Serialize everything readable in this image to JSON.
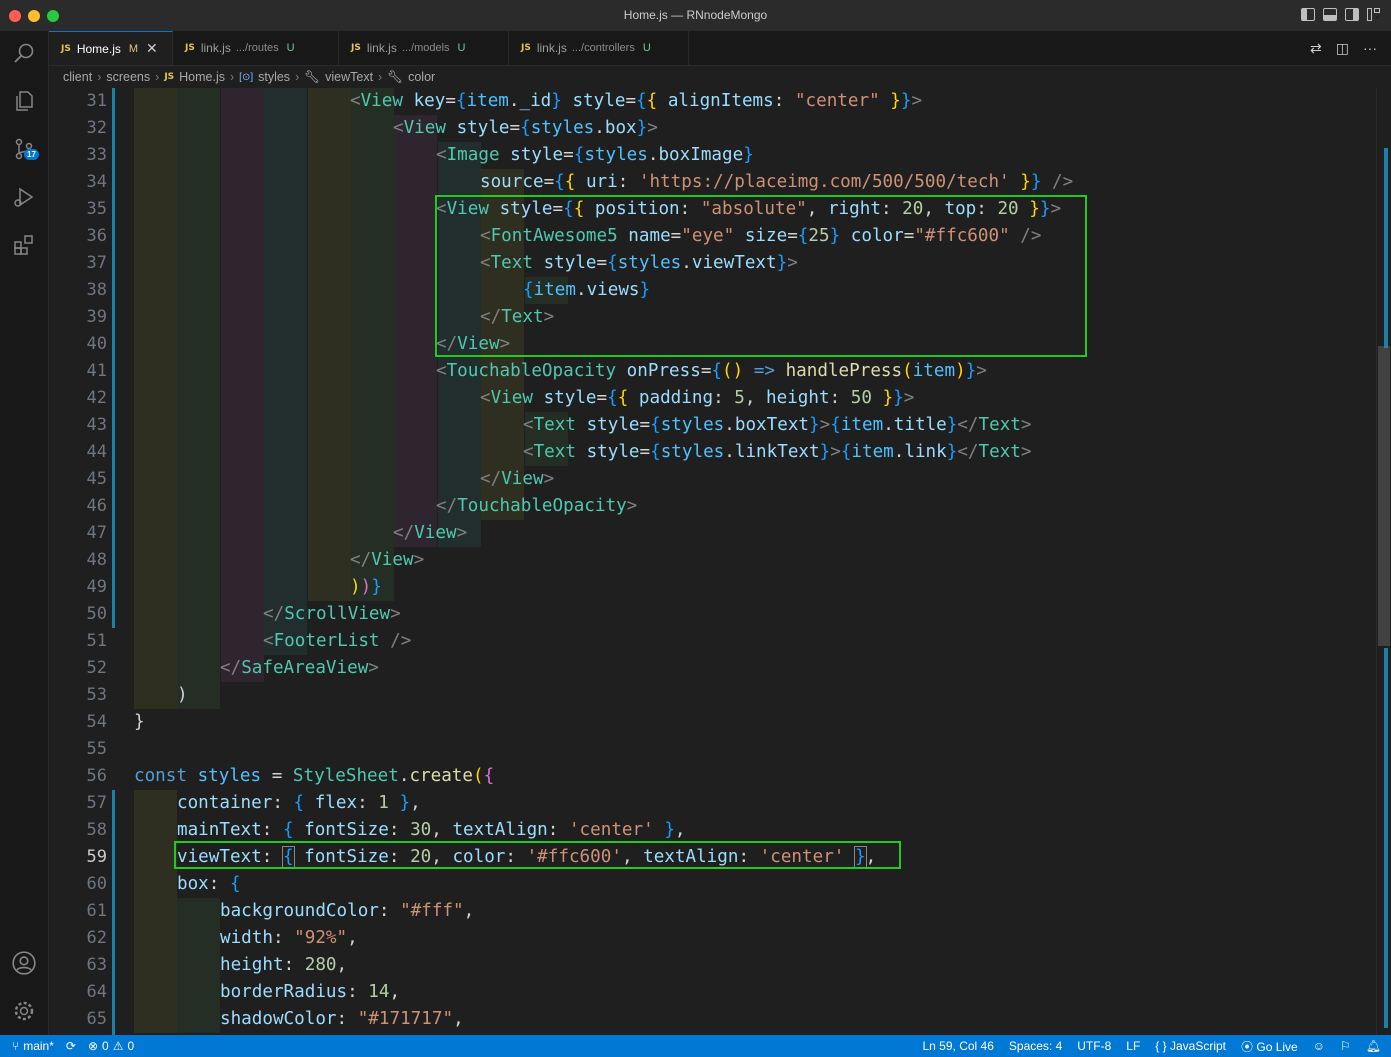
{
  "window": {
    "title": "Home.js — RNnodeMongo"
  },
  "tabs": [
    {
      "label": "Home.js",
      "path": "",
      "status": "M",
      "active": true
    },
    {
      "label": "link.js",
      "path": ".../routes",
      "status": "U",
      "active": false
    },
    {
      "label": "link.js",
      "path": ".../models",
      "status": "U",
      "active": false
    },
    {
      "label": "link.js",
      "path": ".../controllers",
      "status": "U",
      "active": false
    }
  ],
  "breadcrumb": [
    "client",
    "screens",
    "Home.js",
    "styles",
    "viewText",
    "color"
  ],
  "activity": {
    "badge": "17"
  },
  "editor": {
    "current_line": "59",
    "line_numbers": [
      "31",
      "32",
      "33",
      "34",
      "35",
      "36",
      "37",
      "38",
      "39",
      "40",
      "41",
      "42",
      "43",
      "44",
      "45",
      "46",
      "47",
      "48",
      "49",
      "50",
      "51",
      "52",
      "53",
      "54",
      "55",
      "56",
      "57",
      "58",
      "59",
      "60",
      "61",
      "62",
      "63",
      "64",
      "65"
    ]
  },
  "statusbar": {
    "branch": "main*",
    "errors": "0",
    "warnings": "0",
    "position": "Ln 59, Col 46",
    "spaces": "Spaces: 4",
    "encoding": "UTF-8",
    "eol": "LF",
    "language": "JavaScript",
    "golive": "Go Live"
  },
  "icons": {
    "search": "search-icon",
    "explorer": "files-icon",
    "scm": "source-control-icon",
    "debug": "run-debug-icon",
    "extensions": "extensions-icon",
    "account": "account-icon",
    "manage": "gear-icon"
  }
}
